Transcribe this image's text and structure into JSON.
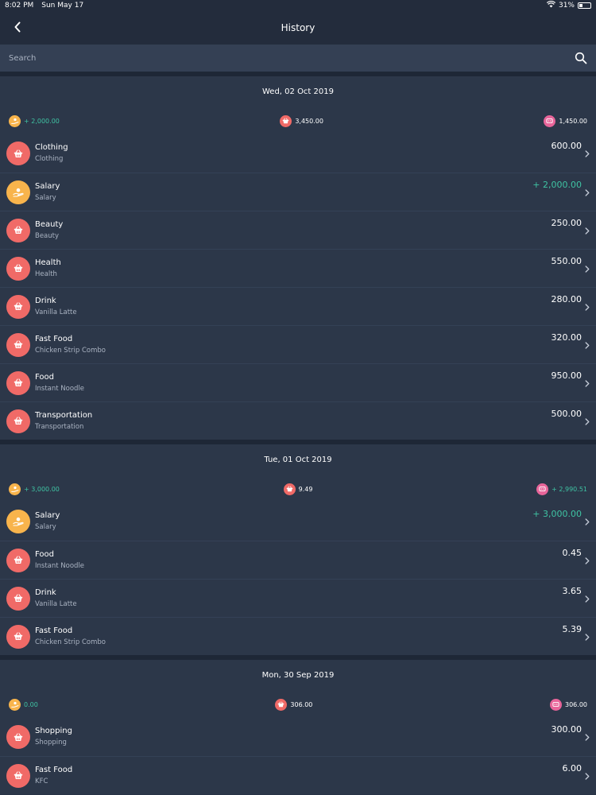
{
  "status": {
    "time": "8:02 PM",
    "date": "Sun May 17",
    "battery": "31%"
  },
  "header": {
    "title": "History"
  },
  "search": {
    "placeholder": "Search"
  },
  "colors": {
    "background": "#283346",
    "income": "#3fc3a3",
    "expense_icon": "#f06a67",
    "income_icon": "#f8b44c",
    "balance_icon": "#e8659a"
  },
  "days": [
    {
      "date": "Wed, 02 Oct 2019",
      "income": "+ 2,000.00",
      "expense": "3,450.00",
      "balance": "1,450.00",
      "balance_is_income": false,
      "transactions": [
        {
          "title": "Clothing",
          "subtitle": "Clothing",
          "amount": "600.00",
          "type": "expense"
        },
        {
          "title": "Salary",
          "subtitle": "Salary",
          "amount": "+ 2,000.00",
          "type": "income"
        },
        {
          "title": "Beauty",
          "subtitle": "Beauty",
          "amount": "250.00",
          "type": "expense"
        },
        {
          "title": "Health",
          "subtitle": "Health",
          "amount": "550.00",
          "type": "expense"
        },
        {
          "title": "Drink",
          "subtitle": "Vanilla Latte",
          "amount": "280.00",
          "type": "expense"
        },
        {
          "title": "Fast Food",
          "subtitle": "Chicken Strip Combo",
          "amount": "320.00",
          "type": "expense"
        },
        {
          "title": "Food",
          "subtitle": "Instant Noodle",
          "amount": "950.00",
          "type": "expense"
        },
        {
          "title": "Transportation",
          "subtitle": "Transportation",
          "amount": "500.00",
          "type": "expense"
        }
      ]
    },
    {
      "date": "Tue, 01 Oct 2019",
      "income": "+ 3,000.00",
      "expense": "9.49",
      "balance": "+ 2,990.51",
      "balance_is_income": true,
      "transactions": [
        {
          "title": "Salary",
          "subtitle": "Salary",
          "amount": "+ 3,000.00",
          "type": "income"
        },
        {
          "title": "Food",
          "subtitle": "Instant Noodle",
          "amount": "0.45",
          "type": "expense"
        },
        {
          "title": "Drink",
          "subtitle": "Vanilla Latte",
          "amount": "3.65",
          "type": "expense"
        },
        {
          "title": "Fast Food",
          "subtitle": "Chicken Strip Combo",
          "amount": "5.39",
          "type": "expense"
        }
      ]
    },
    {
      "date": "Mon, 30 Sep 2019",
      "income": "0.00",
      "expense": "306.00",
      "balance": "306.00",
      "balance_is_income": false,
      "transactions": [
        {
          "title": "Shopping",
          "subtitle": "Shopping",
          "amount": "300.00",
          "type": "expense"
        },
        {
          "title": "Fast Food",
          "subtitle": "KFC",
          "amount": "6.00",
          "type": "expense"
        }
      ]
    }
  ]
}
